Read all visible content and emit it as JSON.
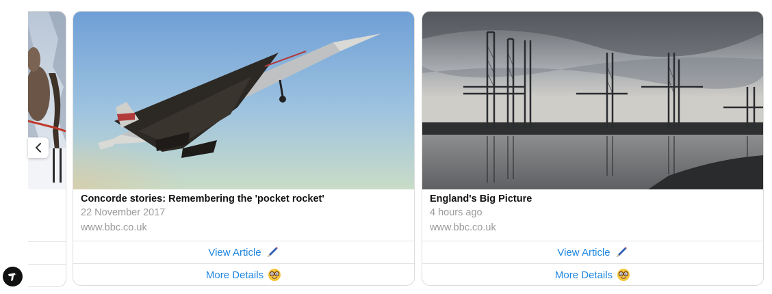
{
  "carousel": {
    "prev_icon": "chevron-left-icon",
    "cards": [
      {
        "title": "Concorde stories: Remembering the 'pocket rocket'",
        "subtitle": "22 November 2017",
        "domain": "www.bbc.co.uk",
        "image": "concorde-photo",
        "buttons": [
          {
            "label": "View Article",
            "icon": "pen-icon"
          },
          {
            "label": "More Details",
            "icon": "nerd-face-icon"
          }
        ]
      },
      {
        "title": "England's Big Picture",
        "subtitle": "4 hours ago",
        "domain": "www.bbc.co.uk",
        "image": "harbour-cranes-photo",
        "buttons": [
          {
            "label": "View Article",
            "icon": "pen-icon"
          },
          {
            "label": "More Details",
            "icon": "nerd-face-icon"
          }
        ]
      }
    ]
  },
  "colors": {
    "link": "#1f86e0",
    "muted_text": "#9a9a9a",
    "border": "#dcdcdc"
  }
}
